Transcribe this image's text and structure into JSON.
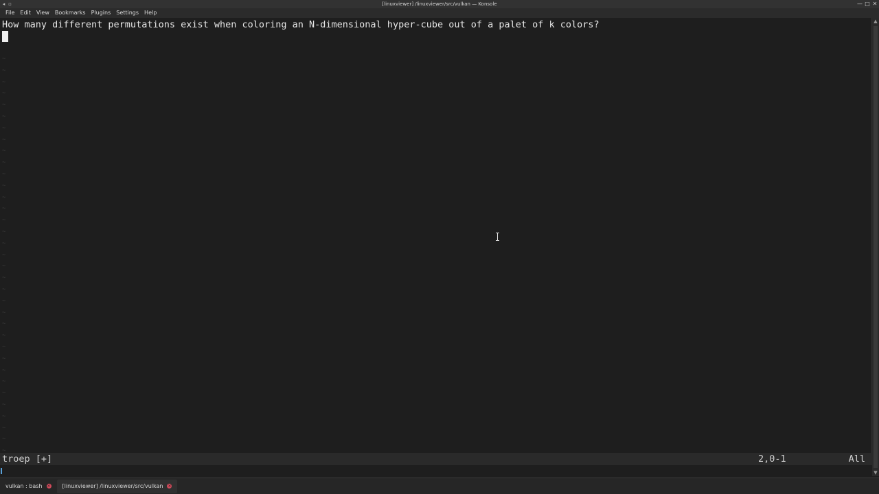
{
  "window": {
    "title": "[linuxviewer] /linuxviewer/src/vulkan — Konsole"
  },
  "menubar": {
    "items": [
      {
        "label": "File"
      },
      {
        "label": "Edit"
      },
      {
        "label": "View"
      },
      {
        "label": "Bookmarks"
      },
      {
        "label": "Plugins"
      },
      {
        "label": "Settings"
      },
      {
        "label": "Help"
      }
    ]
  },
  "editor": {
    "line1": "How many different permutations exist when coloring an N-dimensional hyper-cube out of a palet of k colors?",
    "tilde": "~"
  },
  "statusline": {
    "filename": "troep [+]",
    "position": "2,0-1",
    "scroll": "All"
  },
  "tabs": [
    {
      "label": "vulkan : bash"
    },
    {
      "label": "[linuxviewer] /linuxviewer/src/vulkan"
    }
  ],
  "colors": {
    "background": "#1e1e1e",
    "text": "#e6e6e6",
    "tab_close": "#d04a5a"
  }
}
